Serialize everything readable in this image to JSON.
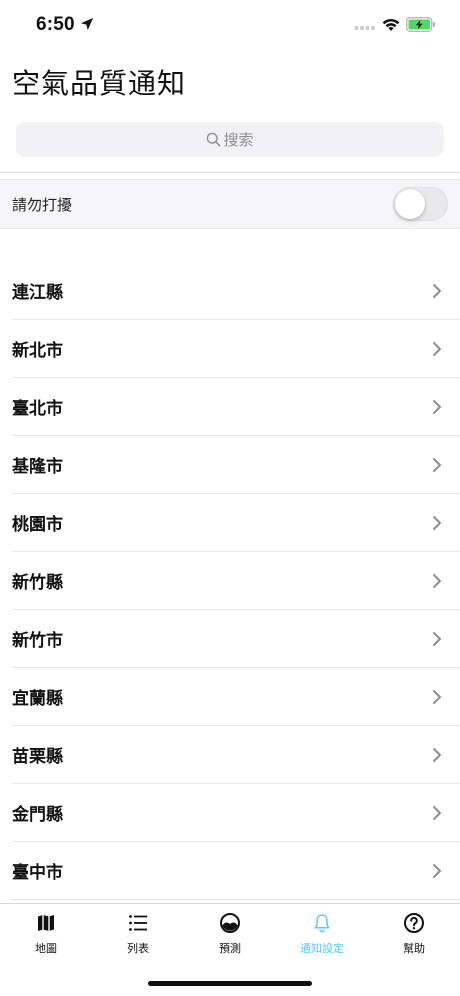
{
  "status_bar": {
    "time": "6:50",
    "icons": [
      "location-arrow-icon",
      "signal-dots-icon",
      "wifi-icon",
      "battery-charging-icon"
    ]
  },
  "header": {
    "title": "空氣品質通知"
  },
  "search": {
    "placeholder": "搜索",
    "icon": "search-icon"
  },
  "dnd": {
    "label": "請勿打擾",
    "enabled": false
  },
  "counties": [
    "連江縣",
    "新北市",
    "臺北市",
    "基隆市",
    "桃園市",
    "新竹縣",
    "新竹市",
    "宜蘭縣",
    "苗栗縣",
    "金門縣",
    "臺中市"
  ],
  "tabs": [
    {
      "label": "地圖",
      "icon": "map-icon",
      "active": false
    },
    {
      "label": "列表",
      "icon": "list-icon",
      "active": false
    },
    {
      "label": "預測",
      "icon": "forecast-icon",
      "active": false
    },
    {
      "label": "通知設定",
      "icon": "bell-icon",
      "active": true
    },
    {
      "label": "幫助",
      "icon": "help-icon",
      "active": false
    }
  ],
  "colors": {
    "accent": "#5ac8fa",
    "battery": "#4cd964",
    "text": "#111111",
    "secondary": "#8e8e93"
  }
}
